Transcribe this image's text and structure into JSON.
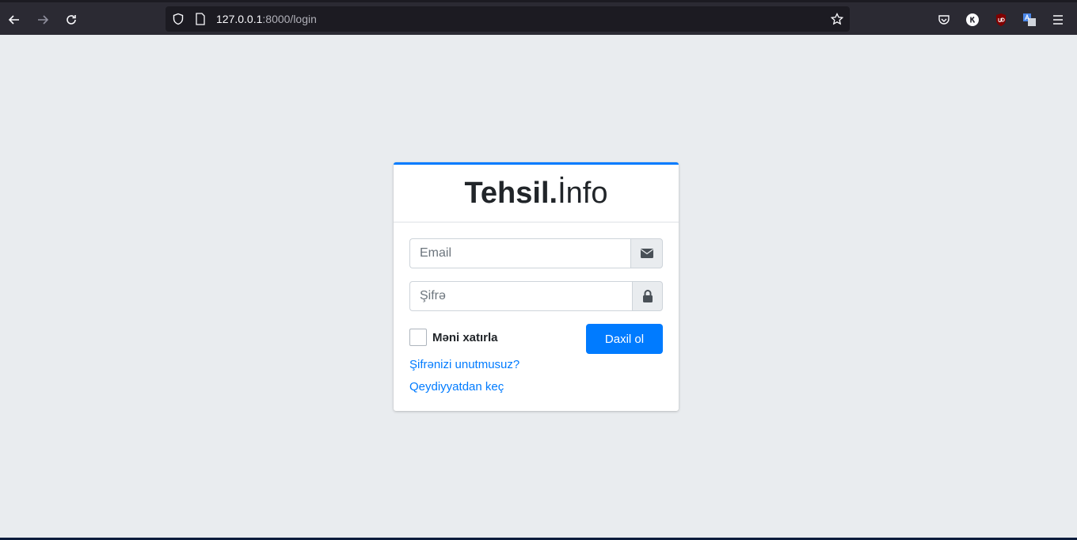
{
  "browser": {
    "url_host": "127.0.0.1",
    "url_rest": ":8000/login",
    "icons": [
      "back-arrow-icon",
      "forward-arrow-icon",
      "reload-icon",
      "shield-icon",
      "page-icon",
      "star-icon",
      "pocket-icon",
      "k-extension-icon",
      "ublock-icon",
      "translate-icon",
      "menu-icon"
    ]
  },
  "login": {
    "brand_bold": "Tehsil.",
    "brand_light": "İnfo",
    "email_placeholder": "Email",
    "password_placeholder": "Şifrə",
    "remember_label": "Məni xatırla",
    "submit_label": "Daxil ol",
    "forgot_link": "Şifrənizi unutmusuz?",
    "register_link": "Qeydiyyatdan keç"
  },
  "colors": {
    "accent": "#007bff",
    "page_bg": "#e9ecef",
    "browser_bg": "#2b2a33"
  }
}
